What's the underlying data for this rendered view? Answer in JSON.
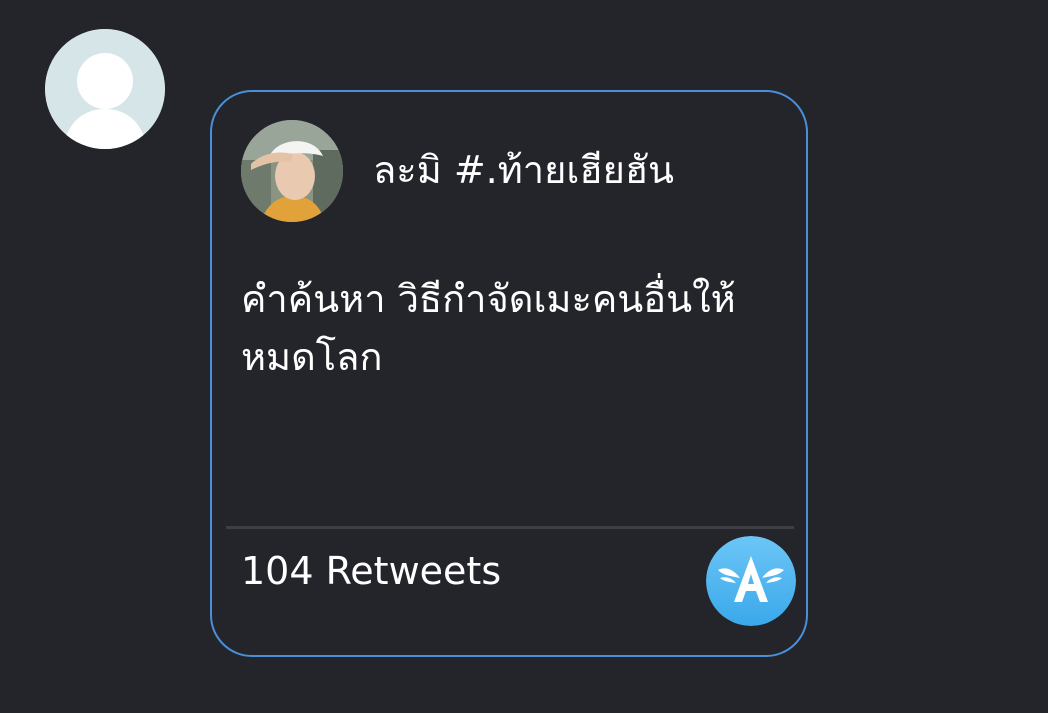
{
  "card": {
    "author_name": "ละมิ #.ท้ายเฮียฮัน",
    "text_line_1": "คำค้นหา วิธีกำจัดเมะคนอื่นให้",
    "text_line_2": "หมดโลก",
    "retweets_label": "104 Retweets"
  },
  "icons": {
    "sender_avatar": "default-user-avatar-icon",
    "author_avatar": "profile-photo",
    "app_badge": "winged-a-app-icon"
  },
  "colors": {
    "background": "#24242b",
    "card_border": "#4a8fd8",
    "divider": "#3e3e45",
    "text": "#ffffff",
    "badge_blue": "#4fb4f0"
  }
}
